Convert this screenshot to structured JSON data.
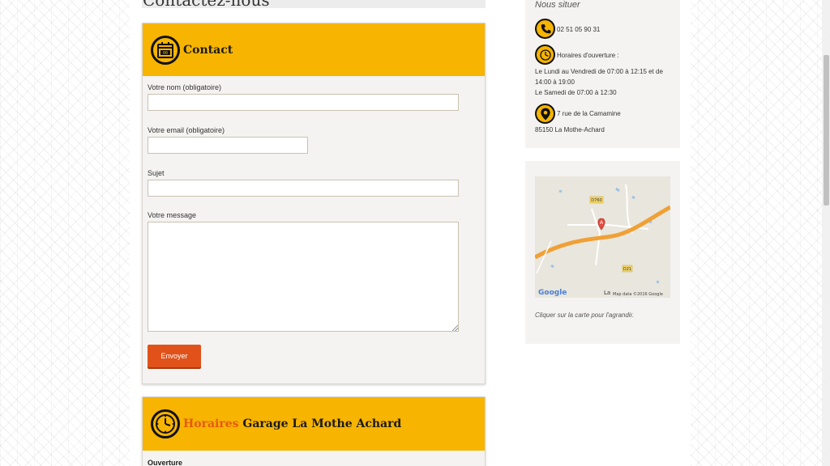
{
  "page": {
    "title": "Contactez-nous"
  },
  "contact": {
    "heading": "Contact",
    "name_label": "Votre nom (obligatoire)",
    "name_value": "",
    "email_label": "Votre email (obligatoire)",
    "email_value": "",
    "subject_label": "Sujet",
    "subject_value": "",
    "message_label": "Votre message",
    "message_value": "",
    "submit_label": "Envoyer"
  },
  "hours_panel": {
    "heading_accent": "Horaires",
    "heading_rest": "Garage La Mothe Achard",
    "sub": "Ouverture"
  },
  "sidebar": {
    "heading": "Nous situer",
    "phone": "02 51 05 90 31",
    "hours_title": "Horaires d'ouverture :",
    "hours_line1": "Le Lundi au Vendredi de 07:00 à 12:15 et de 14:00 à 19:00",
    "hours_line2": "Le Samedi de 07:00 à 12:30",
    "address_line1": "7 rue de la Camamine",
    "address_line2": "85150 La Mothe-Achard",
    "map_caption": "Cliquer sur la carte pour l'agrandir.",
    "map": {
      "road1": "D760",
      "road2": "D21",
      "marker": "A",
      "place": "La",
      "google": "Google",
      "attribution": "Map data ©2016 Google"
    }
  },
  "colors": {
    "accent_yellow": "#f7b400",
    "accent_orange": "#e0521a"
  },
  "icons": [
    "calendar-icon",
    "clock-icon",
    "phone-icon",
    "map-pin-icon"
  ]
}
